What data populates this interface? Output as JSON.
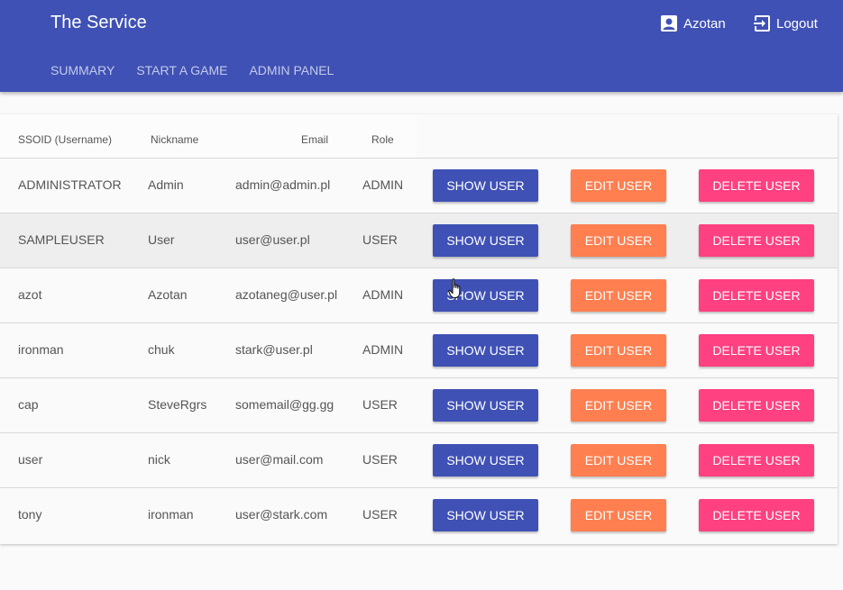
{
  "app": {
    "title": "The Service",
    "username": "Azotan",
    "logout_label": "Logout"
  },
  "nav": [
    {
      "label": "SUMMARY"
    },
    {
      "label": "START A GAME"
    },
    {
      "label": "ADMIN PANEL"
    }
  ],
  "table": {
    "headers": [
      "SSOID (Username)",
      "Nickname",
      "Email",
      "Role"
    ],
    "show_label": "SHOW USER",
    "edit_label": "EDIT USER",
    "delete_label": "DELETE USER",
    "rows": [
      {
        "ssoid": "ADMINISTRATOR",
        "nickname": "Admin",
        "email": "admin@admin.pl",
        "role": "ADMIN"
      },
      {
        "ssoid": "SAMPLEUSER",
        "nickname": "User",
        "email": "user@user.pl",
        "role": "USER"
      },
      {
        "ssoid": "azot",
        "nickname": "Azotan",
        "email": "azotaneg@user.pl",
        "role": "ADMIN"
      },
      {
        "ssoid": "ironman",
        "nickname": "chuk",
        "email": "stark@user.pl",
        "role": "ADMIN"
      },
      {
        "ssoid": "cap",
        "nickname": "SteveRgrs",
        "email": "somemail@gg.gg",
        "role": "USER"
      },
      {
        "ssoid": "user",
        "nickname": "nick",
        "email": "user@mail.com",
        "role": "USER"
      },
      {
        "ssoid": "tony",
        "nickname": "ironman",
        "email": "user@stark.com",
        "role": "USER"
      }
    ]
  },
  "colors": {
    "primary": "#3f51b5",
    "accent_orange": "#ff7f50",
    "accent_pink": "#ff4081"
  },
  "icons": {
    "user": "account-box-icon",
    "logout": "exit-to-app-icon",
    "cursor": "hand-pointer-icon"
  }
}
